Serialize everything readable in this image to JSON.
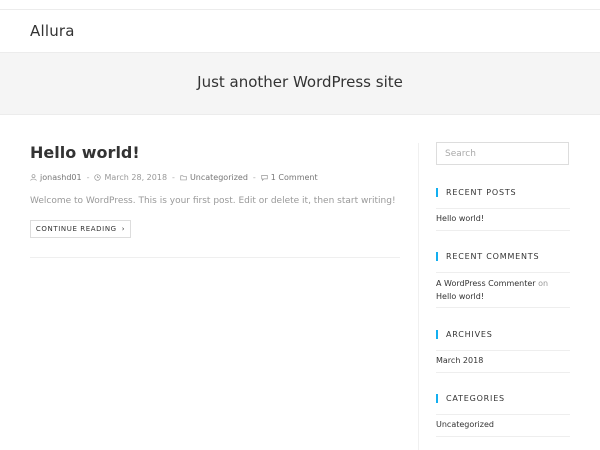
{
  "header": {
    "site_title": "Allura"
  },
  "hero": {
    "tagline": "Just another WordPress site"
  },
  "post": {
    "title": "Hello world!",
    "meta": {
      "author": "jonashd01",
      "date": "March 28, 2018",
      "category": "Uncategorized",
      "comments": "1 Comment",
      "separator": "-"
    },
    "excerpt": "Welcome to WordPress. This is your first post. Edit or delete it, then start writing!",
    "continue_label": "CONTINUE READING",
    "continue_chevron": "›"
  },
  "sidebar": {
    "search_placeholder": "Search",
    "recent_posts": {
      "title": "RECENT POSTS",
      "items": [
        "Hello world!"
      ]
    },
    "recent_comments": {
      "title": "RECENT COMMENTS",
      "author": "A WordPress Commenter",
      "on": "on",
      "post": "Hello world!"
    },
    "archives": {
      "title": "ARCHIVES",
      "items": [
        "March 2018"
      ]
    },
    "categories": {
      "title": "CATEGORIES",
      "items": [
        "Uncategorized"
      ]
    }
  },
  "colors": {
    "accent": "#13aff0",
    "hero_bg": "#f5f5f5",
    "text": "#333333",
    "muted": "#999999"
  }
}
